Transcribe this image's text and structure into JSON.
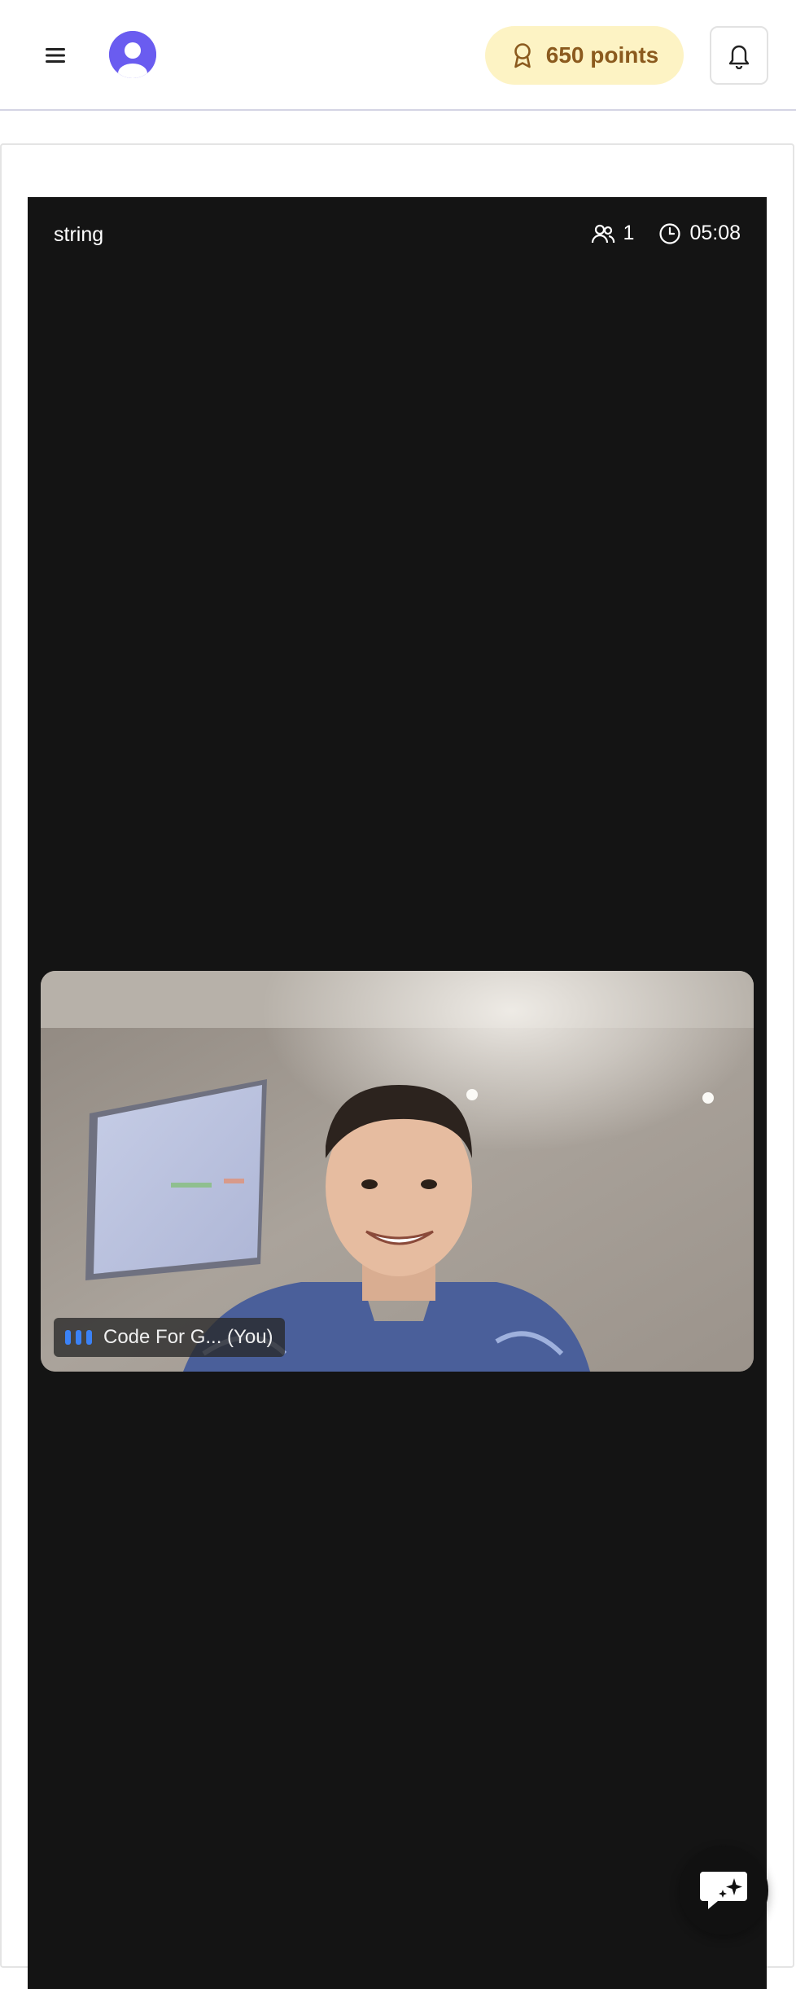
{
  "header": {
    "points_label": "650 points",
    "accent": "#6a5cf0",
    "points_bg": "#fdf3c4",
    "points_color": "#8b5a1e"
  },
  "call": {
    "title": "string",
    "participant_count": "1",
    "duration": "05:08",
    "participant_name": "Code For G... (You)"
  },
  "icons": [
    "menu-icon",
    "user-avatar-icon",
    "award-icon",
    "bell-icon",
    "users-icon",
    "clock-icon",
    "audio-bars-icon",
    "ai-chat-icon"
  ]
}
